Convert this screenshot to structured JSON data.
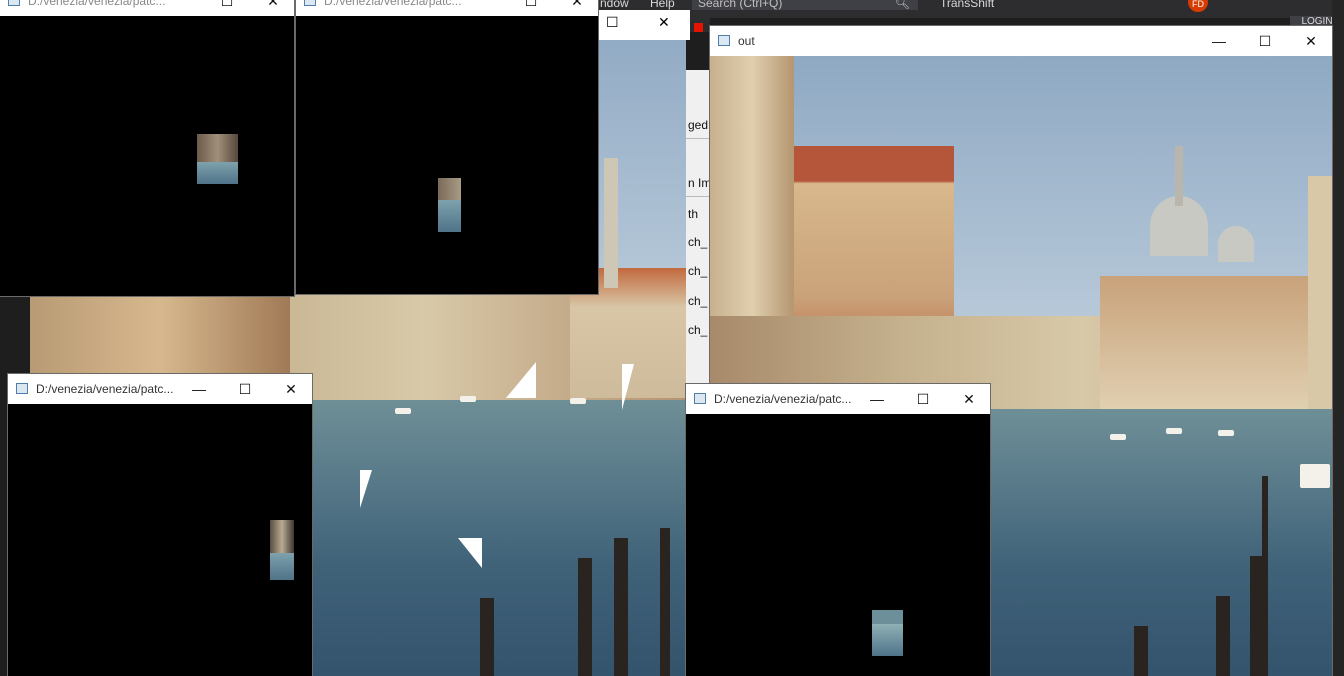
{
  "ide": {
    "menu_window": "ndow",
    "menu_help": "Help",
    "search_text": "Search (Ctrl+Q)",
    "search_icon": "search-icon",
    "title": "TransShift",
    "avatar": "FD",
    "login": "LOGIN",
    "panel_cells": [
      "ged",
      "n Im",
      "th",
      "ch_",
      "ch_",
      "ch_",
      "ch_"
    ]
  },
  "windows": {
    "patch_top_left": {
      "title": "D:/venezia/venezia/patc...",
      "minimize": "—",
      "maximize": "☐",
      "close": "✕"
    },
    "patch_top_mid": {
      "title": "D:/venezia/venezia/patc...",
      "minimize": "—",
      "maximize": "☐",
      "close": "✕"
    },
    "patch_bottom_left": {
      "title": "D:/venezia/venezia/patc...",
      "minimize": "—",
      "maximize": "☐",
      "close": "✕"
    },
    "patch_bottom_right": {
      "title": "D:/venezia/venezia/patc...",
      "minimize": "—",
      "maximize": "☐",
      "close": "✕"
    },
    "out": {
      "title": "out",
      "minimize": "—",
      "maximize": "☐",
      "close": "✕"
    },
    "behind": {
      "maximize": "☐",
      "close": "✕"
    }
  },
  "colors": {
    "titlebar": "#ffffff",
    "window_body": "#000000",
    "ide_background": "#1e1e1e",
    "stop_button": "#e51400"
  }
}
